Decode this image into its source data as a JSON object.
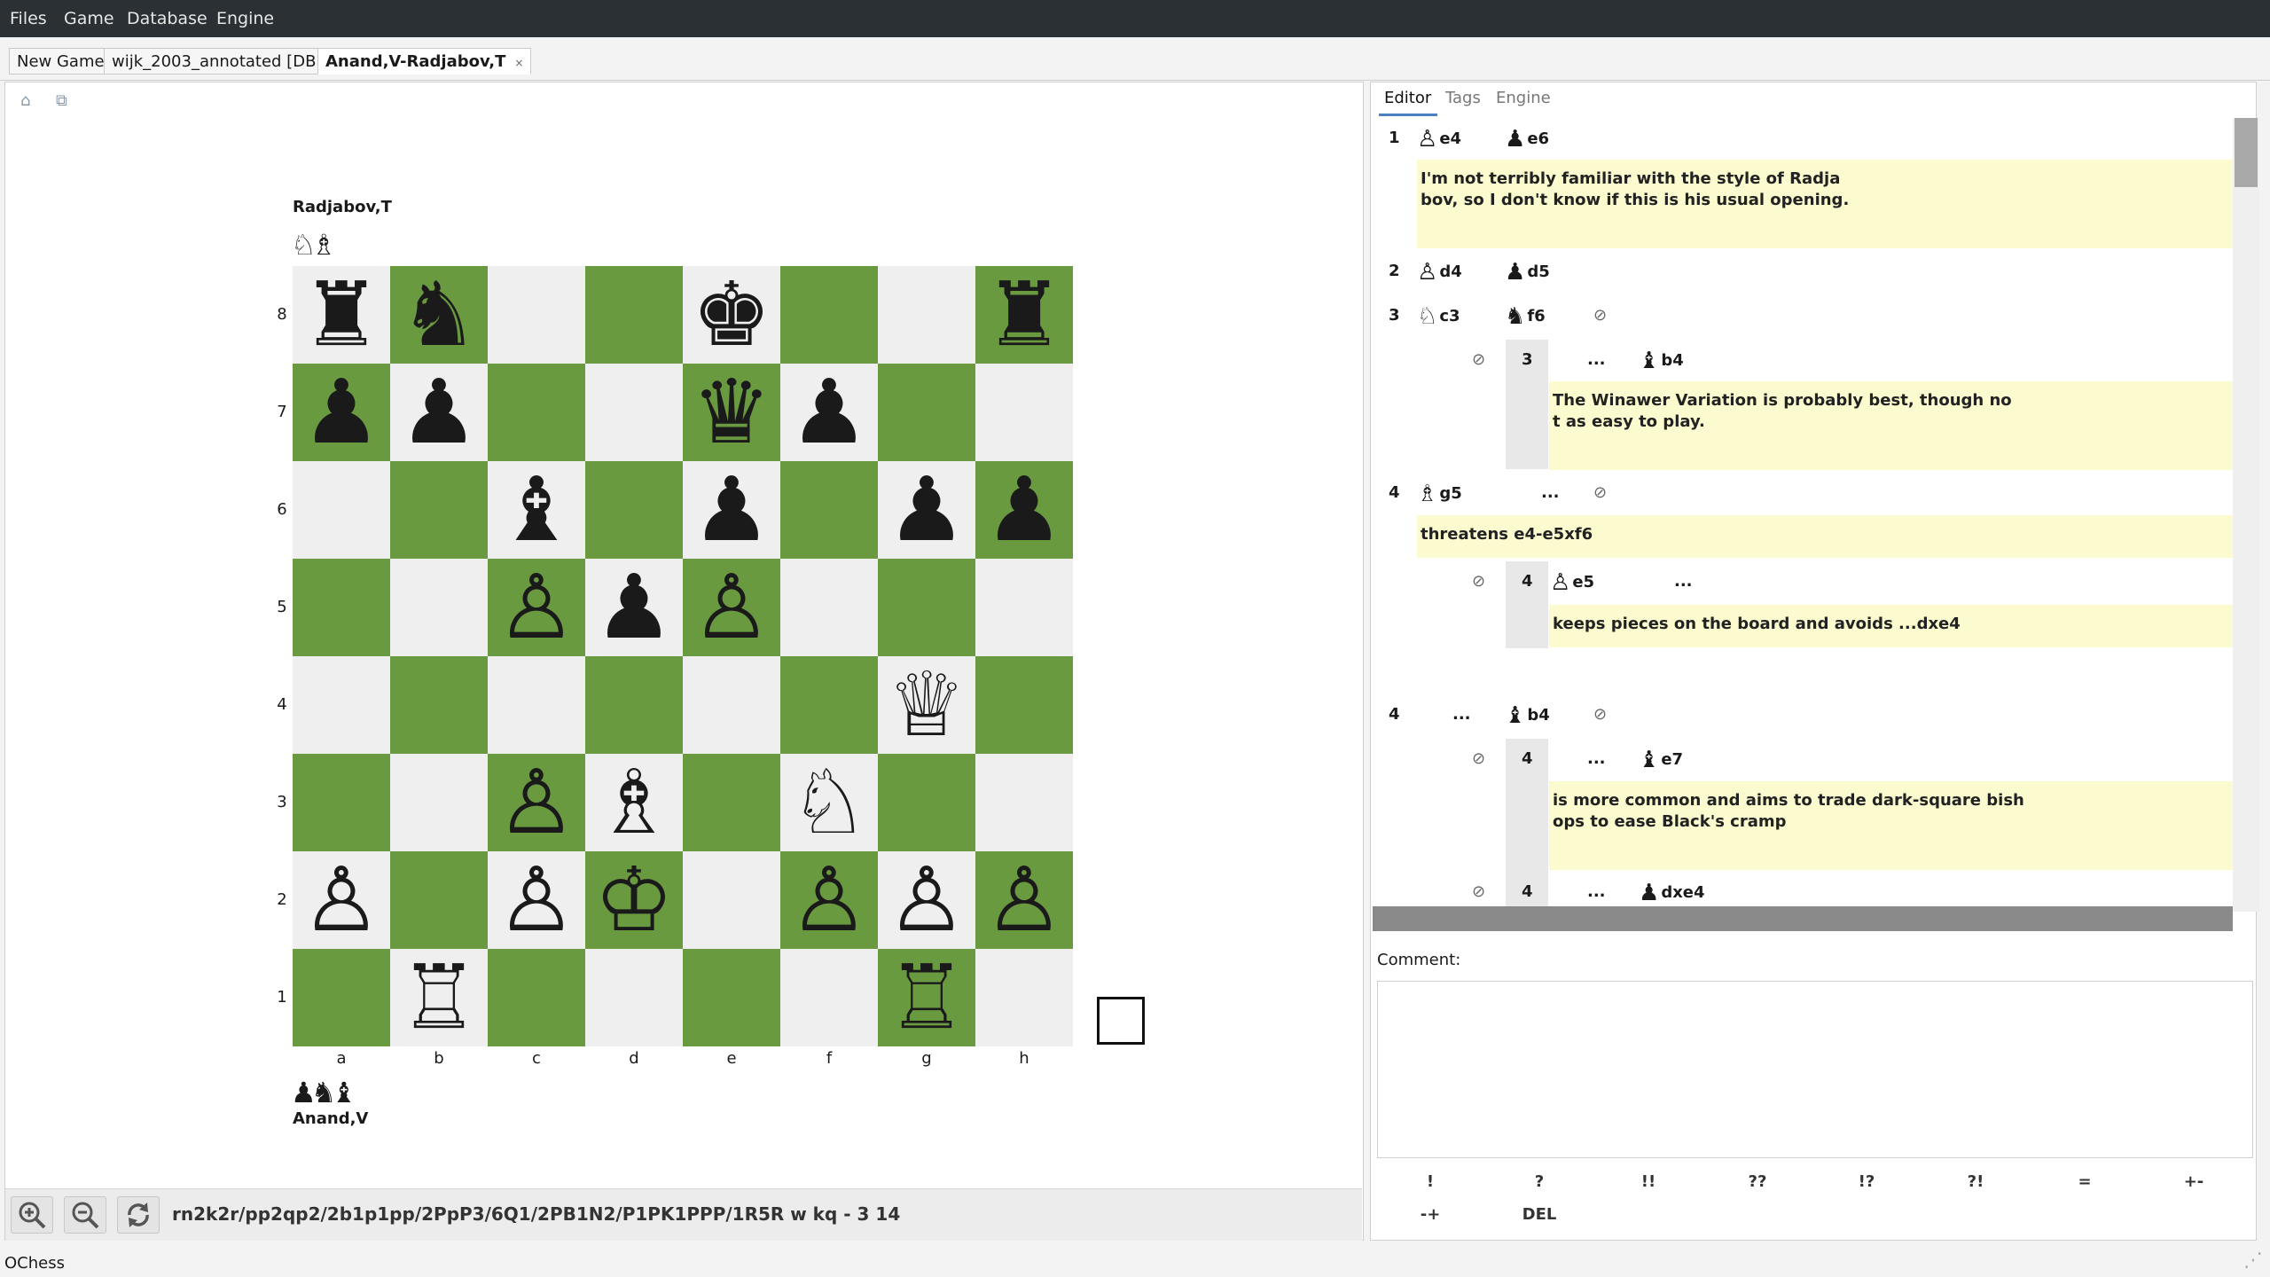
{
  "menu": [
    "Files",
    "Game",
    "Database",
    "Engine"
  ],
  "tabs": [
    {
      "label": "New Game",
      "active": false
    },
    {
      "label": "wijk_2003_annotated [DB]",
      "active": false
    },
    {
      "label": "Anand,V-Radjabov,T",
      "active": true,
      "close": "×"
    }
  ],
  "board": {
    "player_top": "Radjabov,T",
    "player_bottom": "Anand,V",
    "captured_top": "♘♗",
    "captured_bottom": "♟♞♝",
    "flipped": false,
    "ranks": [
      "8",
      "7",
      "6",
      "5",
      "4",
      "3",
      "2",
      "1"
    ],
    "files": [
      "a",
      "b",
      "c",
      "d",
      "e",
      "f",
      "g",
      "h"
    ],
    "rows": [
      [
        "♜",
        "♞",
        "",
        "",
        "♚",
        "",
        "",
        "♜"
      ],
      [
        "♟",
        "♟",
        "",
        "",
        "♛",
        "♟",
        "",
        ""
      ],
      [
        "",
        "",
        "♝",
        "",
        "♟",
        "",
        "♟",
        "♟"
      ],
      [
        "",
        "",
        "♙",
        "♟",
        "♙",
        "",
        "",
        ""
      ],
      [
        "",
        "",
        "",
        "",
        "",
        "",
        "♕",
        ""
      ],
      [
        "",
        "",
        "♙",
        "♗",
        "",
        "♘",
        "",
        ""
      ],
      [
        "♙",
        "",
        "♙",
        "♔",
        "",
        "♙",
        "♙",
        "♙"
      ],
      [
        "",
        "♖",
        "",
        "",
        "",
        "",
        "♖",
        ""
      ]
    ],
    "side_to_move": "white"
  },
  "fen": "rn2k2r/pp2qp2/2b1p1pp/2PpP3/6Q1/2PB1N2/P1PK1PPP/1R5R w kq - 3 14",
  "right_tabs": [
    "Editor",
    "Tags",
    "Engine"
  ],
  "moves": {
    "m1_num": "1",
    "m1_w": "e4",
    "m1_b": "e6",
    "c1": "I'm not terribly familiar with the style of Radja\nbov, so I don't know if this is his usual opening.",
    "m2_num": "2",
    "m2_w": "d4",
    "m2_b": "d5",
    "m3_num": "3",
    "m3_w": "c3",
    "m3_b": "f6",
    "v1_num": "3",
    "v1_ell": "...",
    "v1_mv": "b4",
    "c2": "The Winawer Variation is probably best, though no\nt as easy to play.",
    "m4_num": "4",
    "m4_w": "g5",
    "m4_ell": "...",
    "c3": "threatens e4-e5xf6",
    "v2_num": "4",
    "v2_mv": "e5",
    "v2_ell": "...",
    "c4": "keeps pieces on the board and avoids ...dxe4",
    "m4b_num": "4",
    "m4b_ell": "...",
    "m4b_mv": "b4",
    "v3_num": "4",
    "v3_ell": "...",
    "v3_mv": "e7",
    "c5": "is more common and aims to trade dark-square bish\nops to ease Black's cramp",
    "v4_num": "4",
    "v4_ell": "...",
    "v4_mv": "dxe4"
  },
  "comment_label": "Comment:",
  "nags_row1": [
    "!",
    "?",
    "!!",
    "??",
    "!?",
    "?!",
    "=",
    "+-"
  ],
  "nags_row2": [
    "-+",
    "DEL"
  ],
  "status": "OChess",
  "colors": {
    "dark_square": "#6a9a40",
    "light_square": "#efefef",
    "comment_bg": "#fbfbcf",
    "menubar": "#2a3034"
  }
}
